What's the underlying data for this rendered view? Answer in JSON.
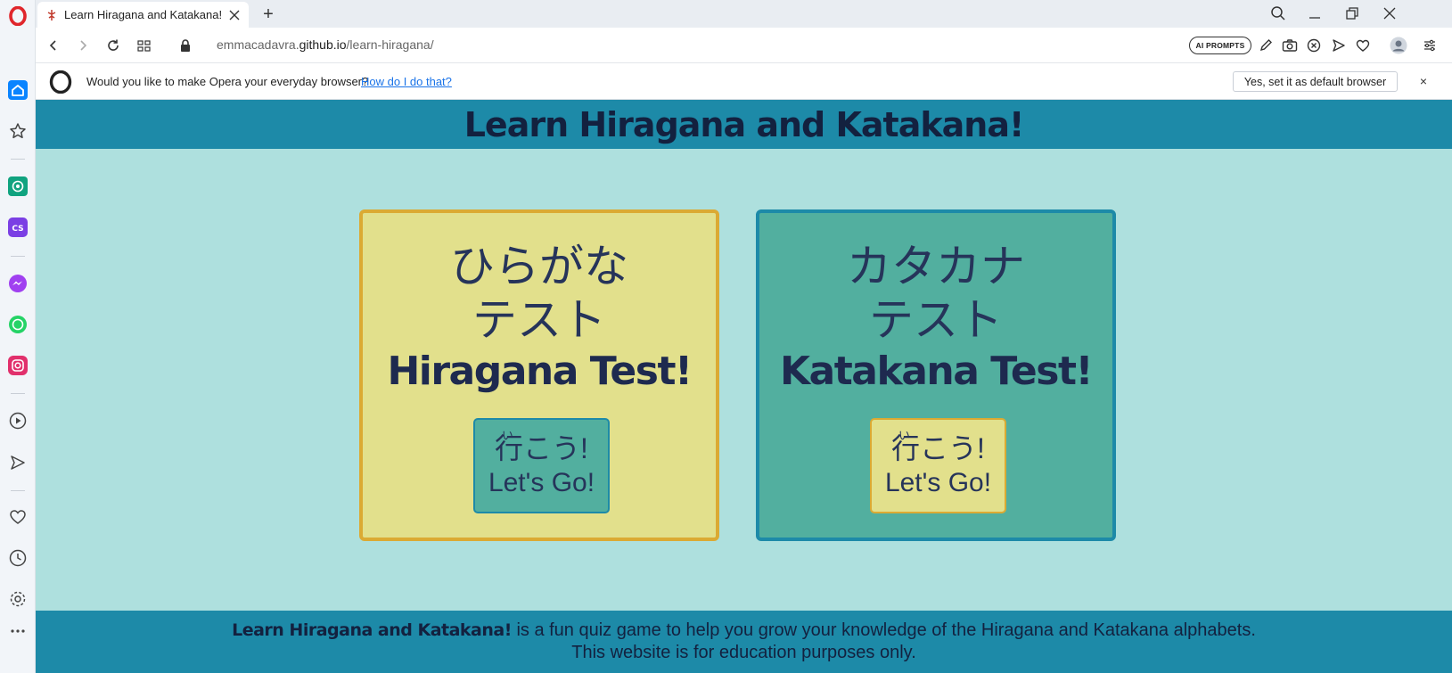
{
  "browser": {
    "tab_title": "Learn Hiragana and Katakana!",
    "url_prefix": "emmacadavra.",
    "url_host": "github.io",
    "url_path": "/learn-hiragana/",
    "ai_prompts_label": "AI PROMPTS",
    "new_tab_symbol": "+"
  },
  "sidebar": {
    "items": [
      "home-icon",
      "bookmarks-icon",
      "chatgpt-icon",
      "chatsonic-icon",
      "messenger-icon",
      "whatsapp-icon",
      "instagram-icon",
      "player-icon",
      "send-icon",
      "heart-icon",
      "history-icon",
      "settings-icon",
      "more-icon"
    ],
    "colors": {
      "home": "#0a84ff",
      "chatgpt": "#10a37f",
      "chatsonic": "#7b3fe4",
      "messenger": "#a040f0",
      "whatsapp": "#25d366",
      "instagram": "#e1306c"
    }
  },
  "infobar": {
    "message": "Would you like to make Opera your everyday browser?",
    "link": "How do I do that?",
    "default_button": "Yes, set it as default browser",
    "close": "×"
  },
  "page": {
    "title": "Learn Hiragana and Katakana!",
    "cards": [
      {
        "jp_line1": "ひらがな",
        "jp_line2": "テスト",
        "en": "Hiragana Test!",
        "btn_furigana": "い",
        "btn_jp": "行こう!",
        "btn_en": "Let's Go!"
      },
      {
        "jp_line1": "カタカナ",
        "jp_line2": "テスト",
        "en": "Katakana Test!",
        "btn_furigana": "い",
        "btn_jp": "行こう!",
        "btn_en": "Let's Go!"
      }
    ],
    "footer": {
      "strong": "Learn Hiragana and Katakana!",
      "text": " is a fun quiz game to help you grow your knowledge of the Hiragana and Katakana alphabets.",
      "line2": "This website is for education purposes only."
    },
    "colors": {
      "header": "#1d8aa8",
      "background": "#aee0de",
      "yellow": "#e2e08c",
      "teal": "#52af9f",
      "gold": "#dbaa33",
      "navy": "#1e2a4f"
    }
  }
}
